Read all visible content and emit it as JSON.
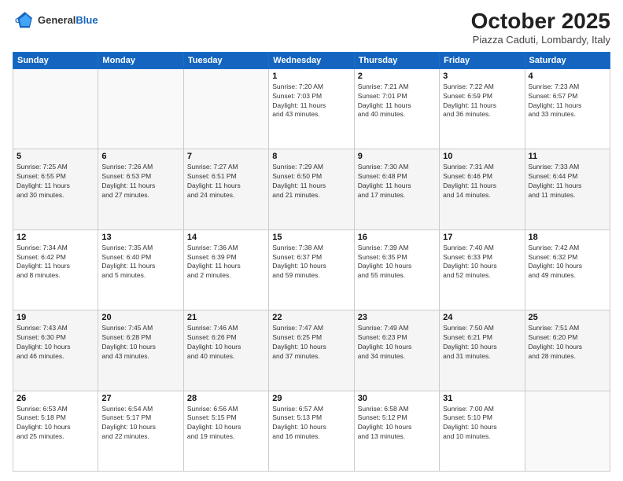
{
  "header": {
    "logo_general": "General",
    "logo_blue": "Blue",
    "month_title": "October 2025",
    "location": "Piazza Caduti, Lombardy, Italy"
  },
  "days_of_week": [
    "Sunday",
    "Monday",
    "Tuesday",
    "Wednesday",
    "Thursday",
    "Friday",
    "Saturday"
  ],
  "weeks": [
    [
      {
        "day": "",
        "info": ""
      },
      {
        "day": "",
        "info": ""
      },
      {
        "day": "",
        "info": ""
      },
      {
        "day": "1",
        "info": "Sunrise: 7:20 AM\nSunset: 7:03 PM\nDaylight: 11 hours\nand 43 minutes."
      },
      {
        "day": "2",
        "info": "Sunrise: 7:21 AM\nSunset: 7:01 PM\nDaylight: 11 hours\nand 40 minutes."
      },
      {
        "day": "3",
        "info": "Sunrise: 7:22 AM\nSunset: 6:59 PM\nDaylight: 11 hours\nand 36 minutes."
      },
      {
        "day": "4",
        "info": "Sunrise: 7:23 AM\nSunset: 6:57 PM\nDaylight: 11 hours\nand 33 minutes."
      }
    ],
    [
      {
        "day": "5",
        "info": "Sunrise: 7:25 AM\nSunset: 6:55 PM\nDaylight: 11 hours\nand 30 minutes."
      },
      {
        "day": "6",
        "info": "Sunrise: 7:26 AM\nSunset: 6:53 PM\nDaylight: 11 hours\nand 27 minutes."
      },
      {
        "day": "7",
        "info": "Sunrise: 7:27 AM\nSunset: 6:51 PM\nDaylight: 11 hours\nand 24 minutes."
      },
      {
        "day": "8",
        "info": "Sunrise: 7:29 AM\nSunset: 6:50 PM\nDaylight: 11 hours\nand 21 minutes."
      },
      {
        "day": "9",
        "info": "Sunrise: 7:30 AM\nSunset: 6:48 PM\nDaylight: 11 hours\nand 17 minutes."
      },
      {
        "day": "10",
        "info": "Sunrise: 7:31 AM\nSunset: 6:46 PM\nDaylight: 11 hours\nand 14 minutes."
      },
      {
        "day": "11",
        "info": "Sunrise: 7:33 AM\nSunset: 6:44 PM\nDaylight: 11 hours\nand 11 minutes."
      }
    ],
    [
      {
        "day": "12",
        "info": "Sunrise: 7:34 AM\nSunset: 6:42 PM\nDaylight: 11 hours\nand 8 minutes."
      },
      {
        "day": "13",
        "info": "Sunrise: 7:35 AM\nSunset: 6:40 PM\nDaylight: 11 hours\nand 5 minutes."
      },
      {
        "day": "14",
        "info": "Sunrise: 7:36 AM\nSunset: 6:39 PM\nDaylight: 11 hours\nand 2 minutes."
      },
      {
        "day": "15",
        "info": "Sunrise: 7:38 AM\nSunset: 6:37 PM\nDaylight: 10 hours\nand 59 minutes."
      },
      {
        "day": "16",
        "info": "Sunrise: 7:39 AM\nSunset: 6:35 PM\nDaylight: 10 hours\nand 55 minutes."
      },
      {
        "day": "17",
        "info": "Sunrise: 7:40 AM\nSunset: 6:33 PM\nDaylight: 10 hours\nand 52 minutes."
      },
      {
        "day": "18",
        "info": "Sunrise: 7:42 AM\nSunset: 6:32 PM\nDaylight: 10 hours\nand 49 minutes."
      }
    ],
    [
      {
        "day": "19",
        "info": "Sunrise: 7:43 AM\nSunset: 6:30 PM\nDaylight: 10 hours\nand 46 minutes."
      },
      {
        "day": "20",
        "info": "Sunrise: 7:45 AM\nSunset: 6:28 PM\nDaylight: 10 hours\nand 43 minutes."
      },
      {
        "day": "21",
        "info": "Sunrise: 7:46 AM\nSunset: 6:26 PM\nDaylight: 10 hours\nand 40 minutes."
      },
      {
        "day": "22",
        "info": "Sunrise: 7:47 AM\nSunset: 6:25 PM\nDaylight: 10 hours\nand 37 minutes."
      },
      {
        "day": "23",
        "info": "Sunrise: 7:49 AM\nSunset: 6:23 PM\nDaylight: 10 hours\nand 34 minutes."
      },
      {
        "day": "24",
        "info": "Sunrise: 7:50 AM\nSunset: 6:21 PM\nDaylight: 10 hours\nand 31 minutes."
      },
      {
        "day": "25",
        "info": "Sunrise: 7:51 AM\nSunset: 6:20 PM\nDaylight: 10 hours\nand 28 minutes."
      }
    ],
    [
      {
        "day": "26",
        "info": "Sunrise: 6:53 AM\nSunset: 5:18 PM\nDaylight: 10 hours\nand 25 minutes."
      },
      {
        "day": "27",
        "info": "Sunrise: 6:54 AM\nSunset: 5:17 PM\nDaylight: 10 hours\nand 22 minutes."
      },
      {
        "day": "28",
        "info": "Sunrise: 6:56 AM\nSunset: 5:15 PM\nDaylight: 10 hours\nand 19 minutes."
      },
      {
        "day": "29",
        "info": "Sunrise: 6:57 AM\nSunset: 5:13 PM\nDaylight: 10 hours\nand 16 minutes."
      },
      {
        "day": "30",
        "info": "Sunrise: 6:58 AM\nSunset: 5:12 PM\nDaylight: 10 hours\nand 13 minutes."
      },
      {
        "day": "31",
        "info": "Sunrise: 7:00 AM\nSunset: 5:10 PM\nDaylight: 10 hours\nand 10 minutes."
      },
      {
        "day": "",
        "info": ""
      }
    ]
  ]
}
